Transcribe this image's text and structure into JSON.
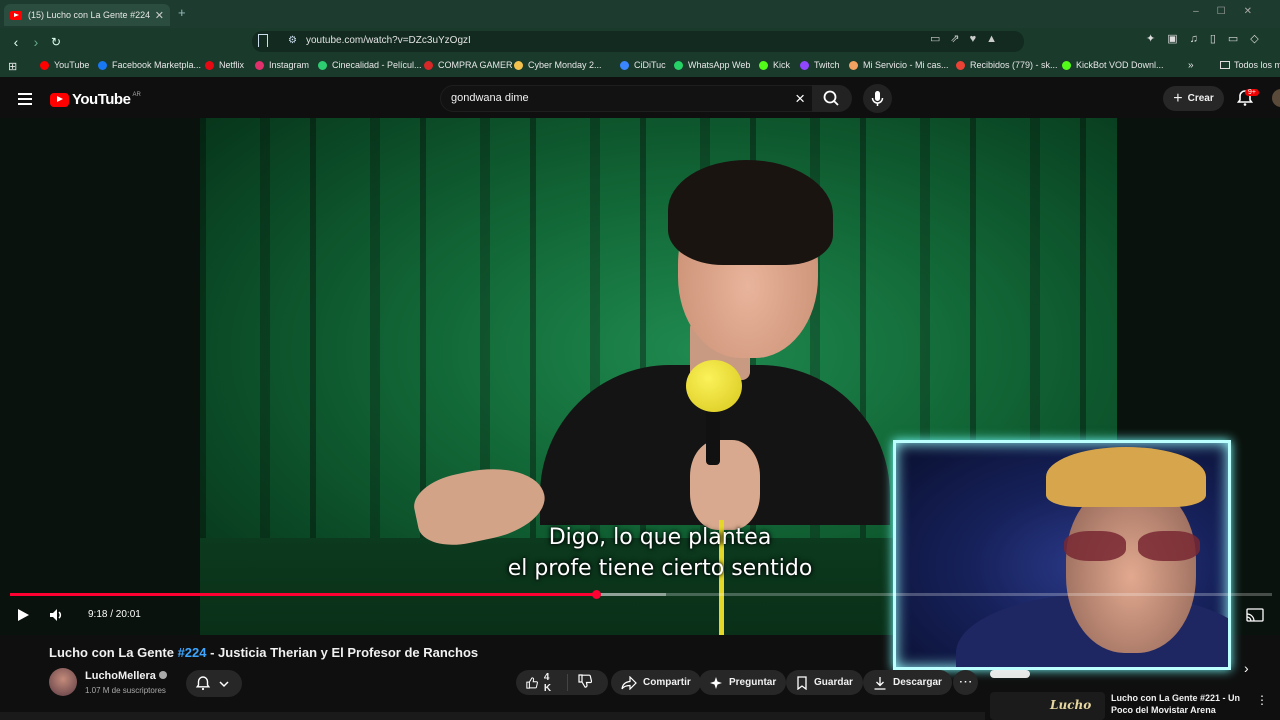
{
  "browser": {
    "tab_title": "(15) Lucho con La Gente #224 -",
    "url": "youtube.com/watch?v=DZc3uYzOgzI",
    "bookmarks": [
      {
        "label": "YouTube",
        "color": "#ff0000"
      },
      {
        "label": "Facebook Marketpla...",
        "color": "#1877f2"
      },
      {
        "label": "Netflix",
        "color": "#e50914"
      },
      {
        "label": "Instagram",
        "color": "#e1306c"
      },
      {
        "label": "Cinecalidad - Películ...",
        "color": "#2ecc71"
      },
      {
        "label": "COMPRA GAMER",
        "color": "#d62828"
      },
      {
        "label": "Cyber Monday 2...",
        "color": "#f2c14e"
      },
      {
        "label": "CiDiTuc",
        "color": "#3a86ff"
      },
      {
        "label": "WhatsApp Web",
        "color": "#25d366"
      },
      {
        "label": "Kick",
        "color": "#53fc18"
      },
      {
        "label": "Twitch",
        "color": "#9146ff"
      },
      {
        "label": "Mi Servicio - Mi cas...",
        "color": "#f4a261"
      },
      {
        "label": "Recibidos (779) - sk...",
        "color": "#ea4335"
      },
      {
        "label": "KickBot VOD Downl...",
        "color": "#53fc18"
      }
    ],
    "bookmarks_overflow": "»",
    "all_bookmarks": "Todos los m"
  },
  "youtube": {
    "logo_text": "YouTube",
    "country_code": "AR",
    "search_value": "gondwana dime",
    "create_label": "Crear",
    "notif_count": "9+"
  },
  "player": {
    "subtitle_line1": "Digo, lo que plantea",
    "subtitle_line2": "el profe tiene cierto sentido",
    "time_display": "9:18 / 20:01",
    "progress_fraction": 0.4647,
    "buffer_fraction": 0.52
  },
  "video": {
    "title_prefix": "Lucho con La Gente ",
    "title_hashtag": "#224",
    "title_suffix": " - Justicia Therian y El Profesor de Ranchos",
    "channel_name": "LuchoMellera",
    "subscribers": "1.07 M de suscriptores",
    "likes": "4 K",
    "share_label": "Compartir",
    "ask_label": "Preguntar",
    "save_label": "Guardar",
    "download_label": "Descargar"
  },
  "suggestion": {
    "title": "Lucho con La Gente #221 - Un Poco del Movistar Arena",
    "thumb_text": "Lucho"
  }
}
